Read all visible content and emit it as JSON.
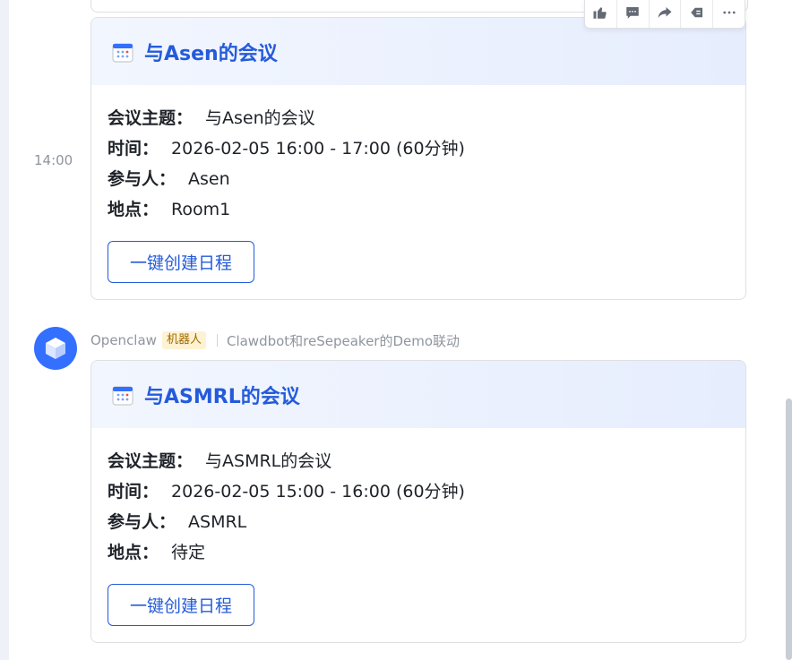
{
  "time_label": "14:00",
  "sender": {
    "name": "Openclaw",
    "badge": "机器人",
    "group": "Clawdbot和reSepeaker的Demo联动"
  },
  "meetings": [
    {
      "title": "与Asen的会议",
      "subject_label": "会议主题：",
      "subject": "与Asen的会议",
      "time_label": "时间：",
      "time": "2026-02-05 16:00 - 17:00 (60分钟)",
      "participants_label": "参与人：",
      "participants": "Asen",
      "location_label": "地点：",
      "location": "Room1",
      "button": "一键创建日程"
    },
    {
      "title": "与ASMRL的会议",
      "subject_label": "会议主题：",
      "subject": "与ASMRL的会议",
      "time_label": "时间：",
      "time": "2026-02-05 15:00 - 16:00 (60分钟)",
      "participants_label": "参与人：",
      "participants": "ASMRL",
      "location_label": "地点：",
      "location": "待定",
      "button": "一键创建日程"
    }
  ],
  "toolbar": [
    "thumbs-up-icon",
    "reply-icon",
    "forward-icon",
    "pin-icon",
    "more-icon"
  ],
  "colors": {
    "accent": "#245bdb",
    "avatar": "#3370ff",
    "badge_bg": "#fdf2d2",
    "badge_text": "#a06a00"
  }
}
